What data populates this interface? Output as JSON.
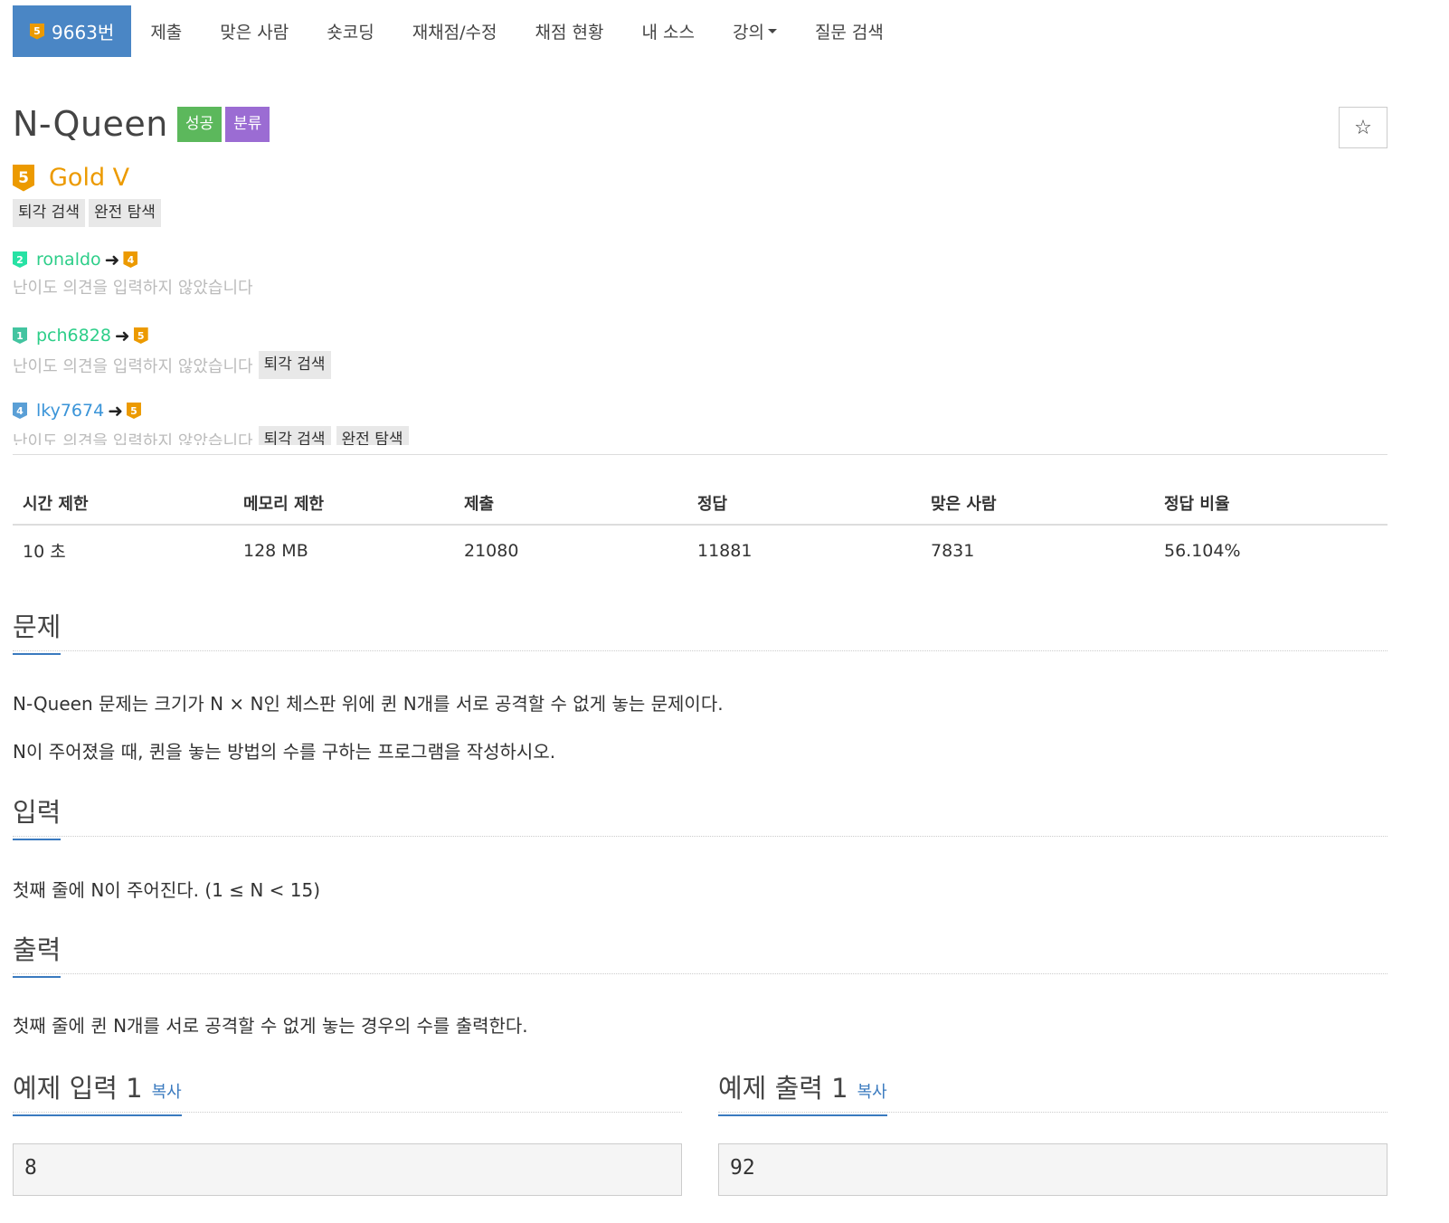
{
  "nav": {
    "problem_tier": "5",
    "problem_number": "9663번",
    "submit": "제출",
    "solved_users": "맞은 사람",
    "short_coding": "숏코딩",
    "rejudge": "재채점/수정",
    "judge_status": "채점 현황",
    "my_source": "내 소스",
    "lecture": "강의",
    "qna_search": "질문 검색"
  },
  "problem": {
    "title": "N-Queen",
    "label_success": "성공",
    "label_category": "분류",
    "star": "☆",
    "tier_number": "5",
    "tier_name": "Gold V",
    "tags": [
      "퇴각 검색",
      "완전 탐색"
    ]
  },
  "opinions": [
    {
      "user_tier": "2",
      "user": "ronaldo",
      "arrow": "➜",
      "vote": "4",
      "text": "난이도 의견을 입력하지 않았습니다",
      "tags": []
    },
    {
      "user_tier": "1",
      "user": "pch6828",
      "arrow": "➜",
      "vote": "5",
      "text": "난이도 의견을 입력하지 않았습니다",
      "tags": [
        "퇴각 검색"
      ]
    },
    {
      "user_tier": "4",
      "user": "lky7674",
      "arrow": "➜",
      "vote": "5",
      "text": "난이도 의견을 입력하지 않았습니다",
      "tags": [
        "퇴각 검색",
        "완전 탐색"
      ]
    }
  ],
  "info": {
    "headers": [
      "시간 제한",
      "메모리 제한",
      "제출",
      "정답",
      "맞은 사람",
      "정답 비율"
    ],
    "values": [
      "10 초",
      "128 MB",
      "21080",
      "11881",
      "7831",
      "56.104%"
    ]
  },
  "sections": {
    "problem_title": "문제",
    "problem_p1": "N-Queen 문제는 크기가 N × N인 체스판 위에 퀸 N개를 서로 공격할 수 없게 놓는 문제이다.",
    "problem_p2": "N이 주어졌을 때, 퀸을 놓는 방법의 수를 구하는 프로그램을 작성하시오.",
    "input_title": "입력",
    "input_p": "첫째 줄에 N이 주어진다. (1 ≤ N < 15)",
    "output_title": "출력",
    "output_p": "첫째 줄에 퀸 N개를 서로 공격할 수 없게 놓는 경우의 수를 출력한다."
  },
  "samples": {
    "input_title": "예제 입력 1",
    "output_title": "예제 출력 1",
    "copy": "복사",
    "input_value": "8",
    "output_value": "92"
  },
  "colors": {
    "nav_active": "#4a86c5",
    "gold": "#ec9a00",
    "success": "#5cb85c",
    "category": "#9b6cd3",
    "link": "#3a7abf"
  }
}
